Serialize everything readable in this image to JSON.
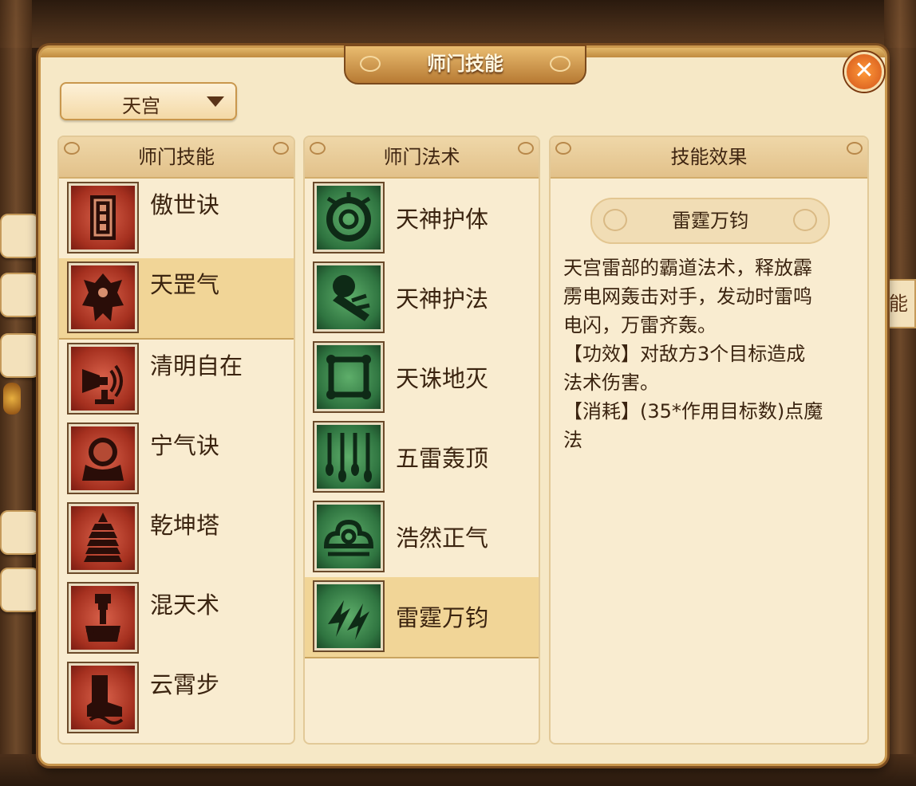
{
  "title": "师门技能",
  "school_dropdown": {
    "selected": "天宫"
  },
  "panels": {
    "skills": {
      "header": "师门技能",
      "items": [
        {
          "label": "傲世诀",
          "icon": "scroll-icon",
          "selected": false
        },
        {
          "label": "天罡气",
          "icon": "guardian-icon",
          "selected": true
        },
        {
          "label": "清明自在",
          "icon": "horn-icon",
          "selected": false
        },
        {
          "label": "宁气诀",
          "icon": "orb-stand-icon",
          "selected": false
        },
        {
          "label": "乾坤塔",
          "icon": "pagoda-icon",
          "selected": false
        },
        {
          "label": "混天术",
          "icon": "chess-rook-icon",
          "selected": false
        },
        {
          "label": "云霄步",
          "icon": "boot-icon",
          "selected": false
        }
      ]
    },
    "spells": {
      "header": "师门法术",
      "items": [
        {
          "label": "天神护体",
          "icon": "shield-ring-icon",
          "selected": false
        },
        {
          "label": "天神护法",
          "icon": "strike-icon",
          "selected": false
        },
        {
          "label": "天诛地灭",
          "icon": "square-frame-icon",
          "selected": false
        },
        {
          "label": "五雷轰顶",
          "icon": "hanging-bolts-icon",
          "selected": false
        },
        {
          "label": "浩然正气",
          "icon": "cloud-swirl-icon",
          "selected": false
        },
        {
          "label": "雷霆万钧",
          "icon": "lightning-icon",
          "selected": true
        }
      ]
    },
    "effect": {
      "header": "技能效果",
      "name": "雷霆万钧",
      "description": [
        "天宫雷部的霸道法术，释放霹",
        "雳电网轰击对手，发动时雷鸣",
        "电闪，万雷齐轰。",
        "【功效】对敌方3个目标造成",
        "法术伤害。",
        "【消耗】(35*作用目标数)点魔",
        "法"
      ]
    }
  },
  "right_edge_tab": "能",
  "colors": {
    "dialog_bg": "#f6e8c6",
    "selected_row": "#f1d597",
    "skill_icon": "#a5301f",
    "spell_icon": "#2f7440",
    "close_button": "#d2541a"
  }
}
